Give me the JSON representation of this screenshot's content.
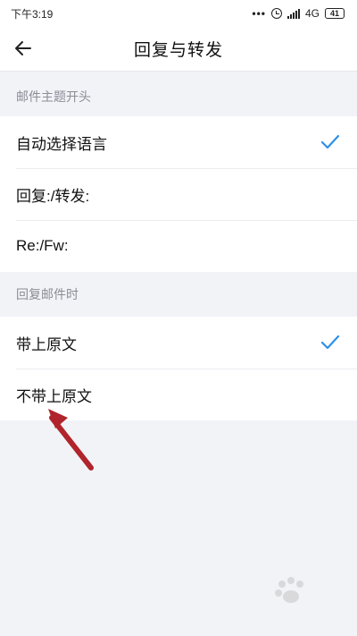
{
  "status_bar": {
    "time": "下午3:19",
    "dots": "•••",
    "network": "4G",
    "battery": "41"
  },
  "header": {
    "title": "回复与转发"
  },
  "sections": [
    {
      "title": "邮件主题开头",
      "items": [
        {
          "label": "自动选择语言",
          "selected": true
        },
        {
          "label": "回复:/转发:",
          "selected": false
        },
        {
          "label": "Re:/Fw:",
          "selected": false
        }
      ]
    },
    {
      "title": "回复邮件时",
      "items": [
        {
          "label": "带上原文",
          "selected": true
        },
        {
          "label": "不带上原文",
          "selected": false
        }
      ]
    }
  ],
  "colors": {
    "accent": "#2f8fea",
    "annotation": "#b0242c"
  },
  "icons": {
    "back": "back-arrow-icon",
    "check": "check-icon",
    "annotation": "red-arrow-annotation-icon",
    "watermark": "baidu-logo-watermark"
  }
}
